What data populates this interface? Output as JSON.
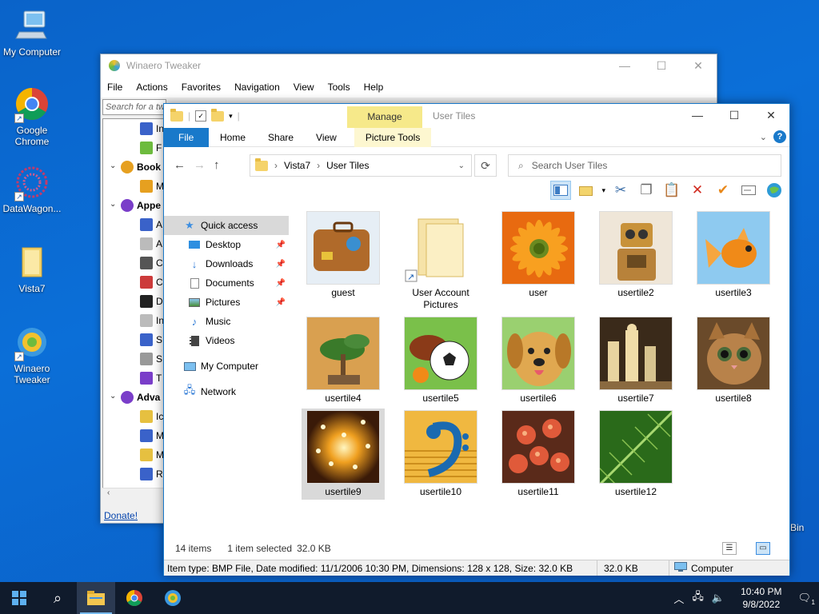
{
  "desktop": {
    "icons": [
      {
        "label": "My Computer"
      },
      {
        "label": "Google Chrome"
      },
      {
        "label": "DataWagon..."
      },
      {
        "label": "Vista7"
      },
      {
        "label": "Winaero Tweaker"
      }
    ],
    "recycle_bin_partial": "Bin"
  },
  "winaero": {
    "title": "Winaero Tweaker",
    "menu": [
      "File",
      "Actions",
      "Favorites",
      "Navigation",
      "View",
      "Tools",
      "Help"
    ],
    "search_placeholder": "Search for a tw",
    "tree": [
      {
        "label": "In",
        "indent": 2
      },
      {
        "label": "F",
        "indent": 2
      },
      {
        "label": "Book",
        "indent": 0,
        "expander": true,
        "bold": true
      },
      {
        "label": "M",
        "indent": 2
      },
      {
        "label": "Appe",
        "indent": 0,
        "expander": true,
        "bold": true
      },
      {
        "label": "A",
        "indent": 2
      },
      {
        "label": "A",
        "indent": 2
      },
      {
        "label": "C",
        "indent": 2
      },
      {
        "label": "C",
        "indent": 2
      },
      {
        "label": "D",
        "indent": 2
      },
      {
        "label": "In",
        "indent": 2
      },
      {
        "label": "S",
        "indent": 2
      },
      {
        "label": "S",
        "indent": 2
      },
      {
        "label": "T",
        "indent": 2
      },
      {
        "label": "Adva",
        "indent": 0,
        "expander": true,
        "bold": true
      },
      {
        "label": "Ic",
        "indent": 2
      },
      {
        "label": "M",
        "indent": 2
      },
      {
        "label": "M",
        "indent": 2
      },
      {
        "label": "R",
        "indent": 2
      }
    ],
    "donate": "Donate!"
  },
  "explorer": {
    "title": "User Tiles",
    "manage_tab": "Manage",
    "ribbon_tabs": [
      "File",
      "Home",
      "Share",
      "View",
      "Picture Tools"
    ],
    "breadcrumb": [
      "Vista7",
      "User Tiles"
    ],
    "search_placeholder": "Search User Tiles",
    "nav": [
      {
        "label": "Quick access",
        "icon": "star-icon",
        "active": true
      },
      {
        "label": "Desktop",
        "icon": "desktop-icon",
        "pinned": true,
        "sub": true
      },
      {
        "label": "Downloads",
        "icon": "download-icon",
        "pinned": true,
        "sub": true
      },
      {
        "label": "Documents",
        "icon": "documents-icon",
        "pinned": true,
        "sub": true
      },
      {
        "label": "Pictures",
        "icon": "pictures-icon",
        "pinned": true,
        "sub": true
      },
      {
        "label": "Music",
        "icon": "music-icon",
        "sub": true
      },
      {
        "label": "Videos",
        "icon": "videos-icon",
        "sub": true
      },
      {
        "label": "My Computer",
        "icon": "computer-icon"
      },
      {
        "label": "Network",
        "icon": "network-icon"
      }
    ],
    "tiles": [
      {
        "label": "guest",
        "art": "suitcase"
      },
      {
        "label": "User Account Pictures",
        "art": "folder"
      },
      {
        "label": "user",
        "art": "flower"
      },
      {
        "label": "usertile2",
        "art": "robot"
      },
      {
        "label": "usertile3",
        "art": "goldfish"
      },
      {
        "label": "usertile4",
        "art": "bonsai"
      },
      {
        "label": "usertile5",
        "art": "balls"
      },
      {
        "label": "usertile6",
        "art": "dog"
      },
      {
        "label": "usertile7",
        "art": "chess"
      },
      {
        "label": "usertile8",
        "art": "kitten"
      },
      {
        "label": "usertile9",
        "art": "sparkle",
        "selected": true
      },
      {
        "label": "usertile10",
        "art": "clef"
      },
      {
        "label": "usertile11",
        "art": "starfish"
      },
      {
        "label": "usertile12",
        "art": "leaf"
      }
    ],
    "status": {
      "items": "14 items",
      "selected": "1 item selected",
      "size": "32.0 KB"
    },
    "info": {
      "details": "Item type: BMP File, Date modified: 11/1/2006 10:30 PM, Dimensions: 128 x 128, Size: 32.0 KB",
      "size": "32.0 KB",
      "location": "Computer"
    }
  },
  "taskbar": {
    "time": "10:40 PM",
    "date": "9/8/2022",
    "notification_count": "1"
  }
}
